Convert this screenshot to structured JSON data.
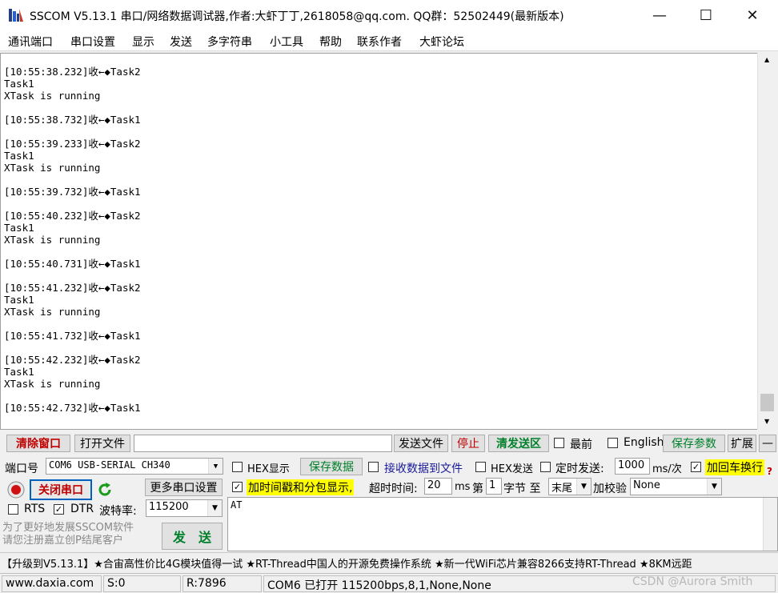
{
  "window": {
    "title": "SSCOM V5.13.1 串口/网络数据调试器,作者:大虾丁丁,2618058@qq.com. QQ群：52502449(最新版本)",
    "minimize": "—",
    "maximize": "☐",
    "close": "✕"
  },
  "menu": [
    "通讯端口",
    "串口设置",
    "显示",
    "发送",
    "多字符串",
    "小工具",
    "帮助",
    "联系作者",
    "大虾论坛"
  ],
  "receive": {
    "text": "[10:55:38.232]收←◆Task2\nTask1\nXTask is running\n\n[10:55:38.732]收←◆Task1\n\n[10:55:39.233]收←◆Task2\nTask1\nXTask is running\n\n[10:55:39.732]收←◆Task1\n\n[10:55:40.232]收←◆Task2\nTask1\nXTask is running\n\n[10:55:40.731]收←◆Task1\n\n[10:55:41.232]收←◆Task2\nTask1\nXTask is running\n\n[10:55:41.732]收←◆Task1\n\n[10:55:42.232]收←◆Task2\nTask1\nXTask is running\n\n[10:55:42.732]收←◆Task1"
  },
  "toolbar": {
    "clear": "清除窗口",
    "open_file": "打开文件",
    "file_path": "",
    "send_file": "发送文件",
    "stop": "停止",
    "clear_send": "清发送区",
    "top_most": "最前",
    "english": "English",
    "save_params": "保存参数",
    "expand": "扩展",
    "collapse": "—"
  },
  "port": {
    "label": "端口号",
    "value": "COM6 USB-SERIAL CH340",
    "close_port": "关闭串口",
    "more_settings": "更多串口设置",
    "rts": "RTS",
    "dtr": "DTR",
    "baud_label": "波特率:",
    "baud_value": "115200"
  },
  "options": {
    "hex_display": "HEX显示",
    "save_data": "保存数据",
    "recv_to_file": "接收数据到文件",
    "hex_send": "HEX发送",
    "timed_send": "定时发送:",
    "interval": "1000",
    "interval_unit": "ms/次",
    "add_crlf": "加回车换行",
    "timestamp": "加时间戳和分包显示,",
    "timeout_label": "超时时间:",
    "timeout_value": "20",
    "timeout_unit": "ms",
    "byte_prefix": "第",
    "byte_index": "1",
    "byte_suffix": "字节 至",
    "byte_end": "末尾",
    "checksum_label": "加校验",
    "checksum_value": "None",
    "help": "?"
  },
  "send": {
    "promo": "为了更好地发展SSCOM软件\n请您注册嘉立创P结尾客户",
    "button": "发　送",
    "text": "AT"
  },
  "ticker": "【升级到V5.13.1】★合宙高性价比4G模块值得一试 ★RT-Thread中国人的开源免费操作系统 ★新一代WiFi芯片兼容8266支持RT-Thread ★8KM远距",
  "status": {
    "site": "www.daxia.com",
    "sent": "S:0",
    "received": "R:7896",
    "port_info": "COM6 已打开  115200bps,8,1,None,None"
  },
  "watermark": "CSDN @Aurora Smith"
}
